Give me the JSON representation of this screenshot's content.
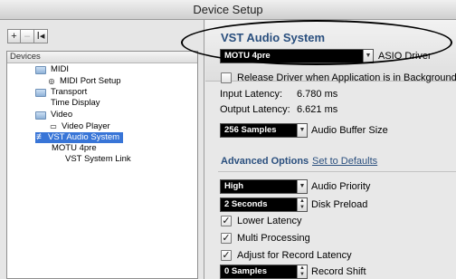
{
  "window": {
    "title": "Device Setup"
  },
  "toolbar": {
    "add": "+",
    "remove": "–",
    "reset": "Ⅰ◂"
  },
  "sidebar": {
    "header": "Devices",
    "items": [
      {
        "label": "MIDI"
      },
      {
        "label": "MIDI Port Setup"
      },
      {
        "label": "Transport"
      },
      {
        "label": "Time Display"
      },
      {
        "label": "Video"
      },
      {
        "label": "Video Player"
      },
      {
        "label": "VST Audio System"
      },
      {
        "label": "MOTU 4pre"
      },
      {
        "label": "VST System Link"
      }
    ]
  },
  "main": {
    "title": "VST Audio System",
    "driver": {
      "value": "MOTU 4pre",
      "label": "ASIO Driver"
    },
    "release_driver": {
      "label": "Release Driver when Application is in Background",
      "checked": false
    },
    "input_latency": {
      "label": "Input Latency:",
      "value": "6.780 ms"
    },
    "output_latency": {
      "label": "Output Latency:",
      "value": "6.621 ms"
    },
    "buffer": {
      "value": "256 Samples",
      "label": "Audio Buffer Size"
    },
    "advanced": {
      "title": "Advanced Options",
      "defaults_link": "Set to Defaults"
    },
    "priority": {
      "value": "High",
      "label": "Audio Priority"
    },
    "preload": {
      "value": "2 Seconds",
      "label": "Disk Preload"
    },
    "lower_latency": {
      "label": "Lower Latency",
      "checked": true
    },
    "multi_processing": {
      "label": "Multi Processing",
      "checked": true
    },
    "adjust_record": {
      "label": "Adjust for Record Latency",
      "checked": true
    },
    "record_shift": {
      "value": "0 Samples",
      "label": "Record Shift"
    }
  },
  "colors": {
    "selection": "#3875d7",
    "heading": "#2a4f7e"
  }
}
